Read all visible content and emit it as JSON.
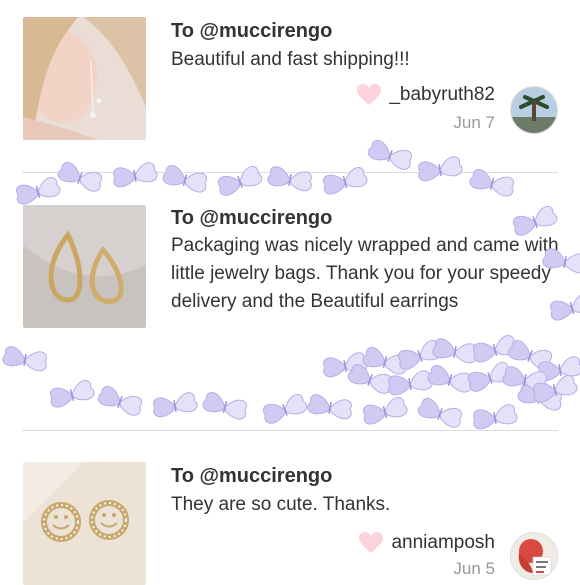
{
  "reviews": [
    {
      "title": "To @muccirengo",
      "text": "Beautiful and fast shipping!!!",
      "username": "_babyruth82",
      "date": "Jun 7",
      "thumbnail": "earrings-on-model-photo",
      "avatar": "palm-tree-photo"
    },
    {
      "title": "To @muccirengo",
      "text": "Packaging was nicely wrapped and came with little jewelry bags. Thank you for your speedy delivery and the Beautiful earrings",
      "thumbnail": "gold-teardrop-hoop-earrings-photo"
    },
    {
      "title": "To @muccirengo",
      "text": "They are so cute. Thanks.",
      "username": "anniamposh",
      "date": "Jun 5",
      "thumbnail": "smiley-face-rhinestone-earrings-photo",
      "avatar": "red-hair-illustration"
    }
  ],
  "colors": {
    "heart": "#fbd3db",
    "divider": "#dcdcdc",
    "date": "#9a9a9a",
    "butterfly": "#c9c6f0"
  },
  "overlay": "butterfly-decoration"
}
